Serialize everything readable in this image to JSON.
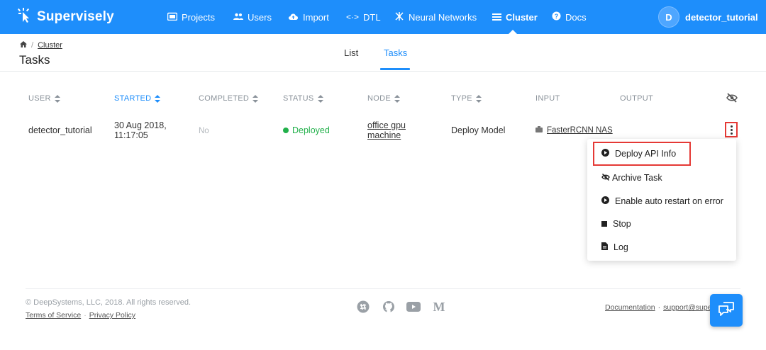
{
  "app": {
    "name": "Supervisely",
    "colors": {
      "brand": "#1e8efb",
      "deployed": "#21b04a",
      "highlight": "#e53935"
    }
  },
  "nav": {
    "items": [
      {
        "label": "Projects",
        "icon": "projects-icon"
      },
      {
        "label": "Users",
        "icon": "users-icon"
      },
      {
        "label": "Import",
        "icon": "cloud-upload-icon"
      },
      {
        "label": "DTL",
        "icon": "code-arrows-icon"
      },
      {
        "label": "Neural Networks",
        "icon": "neural-network-icon"
      },
      {
        "label": "Cluster",
        "icon": "list-icon",
        "active": true
      },
      {
        "label": "Docs",
        "icon": "help-icon"
      }
    ],
    "user": {
      "initial": "D",
      "name": "detector_tutorial"
    }
  },
  "header": {
    "breadcrumb": {
      "link": "Cluster",
      "separator": "/"
    },
    "title": "Tasks",
    "tabs": [
      {
        "label": "List",
        "active": false
      },
      {
        "label": "Tasks",
        "active": true
      }
    ]
  },
  "table": {
    "columns": [
      "USER",
      "STARTED",
      "COMPLETED",
      "STATUS",
      "NODE",
      "TYPE",
      "INPUT",
      "OUTPUT"
    ],
    "active_column": "STARTED",
    "rows": [
      {
        "user": "detector_tutorial",
        "started_date": "30 Aug 2018,",
        "started_time": "11:17:05",
        "completed": "No",
        "status": "Deployed",
        "node_line1": "office gpu",
        "node_line2": "machine",
        "type": "Deploy Model",
        "input": "FasterRCNN NAS",
        "output": ""
      }
    ]
  },
  "context_menu": {
    "items": [
      {
        "label": "Deploy API Info",
        "icon": "play-circle-icon",
        "highlighted": true
      },
      {
        "label": "Archive Task",
        "icon": "eye-off-icon"
      },
      {
        "label": "Enable auto restart on error",
        "icon": "play-circle-icon"
      },
      {
        "label": "Stop",
        "icon": "stop-icon"
      },
      {
        "label": "Log",
        "icon": "file-icon"
      }
    ]
  },
  "footer": {
    "copyright": "© DeepSystems, LLC, 2018. All rights reserved.",
    "terms": "Terms of Service",
    "privacy": "Privacy Policy",
    "separator": "·",
    "documentation": "Documentation",
    "support": "support@supervise.ly",
    "social": [
      "slack-icon",
      "github-icon",
      "youtube-icon",
      "medium-icon"
    ]
  }
}
